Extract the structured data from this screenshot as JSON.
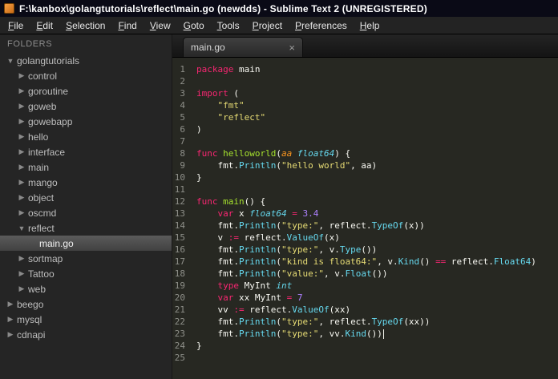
{
  "window": {
    "title": "F:\\kanbox\\golangtutorials\\reflect\\main.go (newdds) - Sublime Text 2 (UNREGISTERED)"
  },
  "icons": {
    "chevron_right": "▶",
    "chevron_down": "▼",
    "close": "×"
  },
  "menu": {
    "items": [
      {
        "label": "File",
        "underline": 0
      },
      {
        "label": "Edit",
        "underline": 0
      },
      {
        "label": "Selection",
        "underline": 0
      },
      {
        "label": "Find",
        "underline": 0
      },
      {
        "label": "View",
        "underline": 0
      },
      {
        "label": "Goto",
        "underline": 0
      },
      {
        "label": "Tools",
        "underline": 0
      },
      {
        "label": "Project",
        "underline": 0
      },
      {
        "label": "Preferences",
        "underline": 0
      },
      {
        "label": "Help",
        "underline": 0
      }
    ]
  },
  "sidebar": {
    "header": "FOLDERS",
    "items": [
      {
        "label": "golangtutorials",
        "depth": 0,
        "type": "folder",
        "expanded": true
      },
      {
        "label": "control",
        "depth": 1,
        "type": "folder",
        "expanded": false
      },
      {
        "label": "goroutine",
        "depth": 1,
        "type": "folder",
        "expanded": false
      },
      {
        "label": "goweb",
        "depth": 1,
        "type": "folder",
        "expanded": false
      },
      {
        "label": "gowebapp",
        "depth": 1,
        "type": "folder",
        "expanded": false
      },
      {
        "label": "hello",
        "depth": 1,
        "type": "folder",
        "expanded": false
      },
      {
        "label": "interface",
        "depth": 1,
        "type": "folder",
        "expanded": false
      },
      {
        "label": "main",
        "depth": 1,
        "type": "folder",
        "expanded": false
      },
      {
        "label": "mango",
        "depth": 1,
        "type": "folder",
        "expanded": false
      },
      {
        "label": "object",
        "depth": 1,
        "type": "folder",
        "expanded": false
      },
      {
        "label": "oscmd",
        "depth": 1,
        "type": "folder",
        "expanded": false
      },
      {
        "label": "reflect",
        "depth": 1,
        "type": "folder",
        "expanded": true
      },
      {
        "label": "main.go",
        "depth": 2,
        "type": "file",
        "selected": true
      },
      {
        "label": "sortmap",
        "depth": 1,
        "type": "folder",
        "expanded": false
      },
      {
        "label": "Tattoo",
        "depth": 1,
        "type": "folder",
        "expanded": false
      },
      {
        "label": "web",
        "depth": 1,
        "type": "folder",
        "expanded": false
      },
      {
        "label": "beego",
        "depth": 0,
        "type": "folder",
        "expanded": false
      },
      {
        "label": "mysql",
        "depth": 0,
        "type": "folder",
        "expanded": false
      },
      {
        "label": "cdnapi",
        "depth": 0,
        "type": "folder",
        "expanded": false
      }
    ]
  },
  "tabs": [
    {
      "label": "main.go",
      "active": true
    }
  ],
  "editor": {
    "caret_line": 23,
    "lines": [
      [
        {
          "t": "package",
          "c": "k"
        },
        {
          "t": " main",
          "c": "p"
        }
      ],
      [],
      [
        {
          "t": "import",
          "c": "k"
        },
        {
          "t": " (",
          "c": "p"
        }
      ],
      [
        {
          "t": "    ",
          "c": "p"
        },
        {
          "t": "\"fmt\"",
          "c": "s"
        }
      ],
      [
        {
          "t": "    ",
          "c": "p"
        },
        {
          "t": "\"reflect\"",
          "c": "s"
        }
      ],
      [
        {
          "t": ")",
          "c": "p"
        }
      ],
      [],
      [
        {
          "t": "func",
          "c": "k"
        },
        {
          "t": " ",
          "c": "p"
        },
        {
          "t": "helloworld",
          "c": "f"
        },
        {
          "t": "(",
          "c": "p"
        },
        {
          "t": "aa",
          "c": "a"
        },
        {
          "t": " ",
          "c": "p"
        },
        {
          "t": "float64",
          "c": "t"
        },
        {
          "t": ") {",
          "c": "p"
        }
      ],
      [
        {
          "t": "    fmt.",
          "c": "p"
        },
        {
          "t": "Println",
          "c": "c"
        },
        {
          "t": "(",
          "c": "p"
        },
        {
          "t": "\"hello world\"",
          "c": "s"
        },
        {
          "t": ", aa)",
          "c": "p"
        }
      ],
      [
        {
          "t": "}",
          "c": "p"
        }
      ],
      [],
      [
        {
          "t": "func",
          "c": "k"
        },
        {
          "t": " ",
          "c": "p"
        },
        {
          "t": "main",
          "c": "f"
        },
        {
          "t": "() {",
          "c": "p"
        }
      ],
      [
        {
          "t": "    ",
          "c": "p"
        },
        {
          "t": "var",
          "c": "k"
        },
        {
          "t": " x ",
          "c": "p"
        },
        {
          "t": "float64",
          "c": "t"
        },
        {
          "t": " ",
          "c": "p"
        },
        {
          "t": "=",
          "c": "k"
        },
        {
          "t": " ",
          "c": "p"
        },
        {
          "t": "3.4",
          "c": "n"
        }
      ],
      [
        {
          "t": "    fmt.",
          "c": "p"
        },
        {
          "t": "Println",
          "c": "c"
        },
        {
          "t": "(",
          "c": "p"
        },
        {
          "t": "\"type:\"",
          "c": "s"
        },
        {
          "t": ", reflect.",
          "c": "p"
        },
        {
          "t": "TypeOf",
          "c": "c"
        },
        {
          "t": "(x))",
          "c": "p"
        }
      ],
      [
        {
          "t": "    v ",
          "c": "p"
        },
        {
          "t": ":=",
          "c": "k"
        },
        {
          "t": " reflect.",
          "c": "p"
        },
        {
          "t": "ValueOf",
          "c": "c"
        },
        {
          "t": "(x)",
          "c": "p"
        }
      ],
      [
        {
          "t": "    fmt.",
          "c": "p"
        },
        {
          "t": "Println",
          "c": "c"
        },
        {
          "t": "(",
          "c": "p"
        },
        {
          "t": "\"type:\"",
          "c": "s"
        },
        {
          "t": ", v.",
          "c": "p"
        },
        {
          "t": "Type",
          "c": "c"
        },
        {
          "t": "())",
          "c": "p"
        }
      ],
      [
        {
          "t": "    fmt.",
          "c": "p"
        },
        {
          "t": "Println",
          "c": "c"
        },
        {
          "t": "(",
          "c": "p"
        },
        {
          "t": "\"kind is float64:\"",
          "c": "s"
        },
        {
          "t": ", v.",
          "c": "p"
        },
        {
          "t": "Kind",
          "c": "c"
        },
        {
          "t": "() ",
          "c": "p"
        },
        {
          "t": "==",
          "c": "k"
        },
        {
          "t": " reflect.",
          "c": "p"
        },
        {
          "t": "Float64",
          "c": "c"
        },
        {
          "t": ")",
          "c": "p"
        }
      ],
      [
        {
          "t": "    fmt.",
          "c": "p"
        },
        {
          "t": "Println",
          "c": "c"
        },
        {
          "t": "(",
          "c": "p"
        },
        {
          "t": "\"value:\"",
          "c": "s"
        },
        {
          "t": ", v.",
          "c": "p"
        },
        {
          "t": "Float",
          "c": "c"
        },
        {
          "t": "())",
          "c": "p"
        }
      ],
      [
        {
          "t": "    ",
          "c": "p"
        },
        {
          "t": "type",
          "c": "k"
        },
        {
          "t": " MyInt ",
          "c": "p"
        },
        {
          "t": "int",
          "c": "t"
        }
      ],
      [
        {
          "t": "    ",
          "c": "p"
        },
        {
          "t": "var",
          "c": "k"
        },
        {
          "t": " xx MyInt ",
          "c": "p"
        },
        {
          "t": "=",
          "c": "k"
        },
        {
          "t": " ",
          "c": "p"
        },
        {
          "t": "7",
          "c": "n"
        }
      ],
      [
        {
          "t": "    vv ",
          "c": "p"
        },
        {
          "t": ":=",
          "c": "k"
        },
        {
          "t": " reflect.",
          "c": "p"
        },
        {
          "t": "ValueOf",
          "c": "c"
        },
        {
          "t": "(xx)",
          "c": "p"
        }
      ],
      [
        {
          "t": "    fmt.",
          "c": "p"
        },
        {
          "t": "Println",
          "c": "c"
        },
        {
          "t": "(",
          "c": "p"
        },
        {
          "t": "\"type:\"",
          "c": "s"
        },
        {
          "t": ", reflect.",
          "c": "p"
        },
        {
          "t": "TypeOf",
          "c": "c"
        },
        {
          "t": "(xx))",
          "c": "p"
        }
      ],
      [
        {
          "t": "    fmt.",
          "c": "p"
        },
        {
          "t": "Println",
          "c": "c"
        },
        {
          "t": "(",
          "c": "p"
        },
        {
          "t": "\"type:\"",
          "c": "s"
        },
        {
          "t": ", vv.",
          "c": "p"
        },
        {
          "t": "Kind",
          "c": "c"
        },
        {
          "t": "())",
          "c": "p"
        }
      ],
      [
        {
          "t": "}",
          "c": "p"
        }
      ],
      []
    ]
  },
  "colors": {
    "titlebar_bg": "#0a0a16",
    "menubar_bg": "#232323",
    "sidebar_bg": "#252525",
    "sidebar_selected_top": "#5b5b5b",
    "sidebar_selected_bottom": "#414141",
    "tabbar_bg_top": "#242424",
    "tabbar_bg_bottom": "#141414",
    "tab_active_top": "#404040",
    "tab_active_bottom": "#282828",
    "editor_bg": "#272822",
    "gutter_fg": "#8f908a",
    "plain": "#f8f8f2",
    "keyword": "#f92672",
    "string": "#e6db74",
    "number": "#ae81ff",
    "func_name": "#a6e22e",
    "type": "#66d9ef",
    "call": "#66d9ef",
    "param": "#fd971f"
  }
}
